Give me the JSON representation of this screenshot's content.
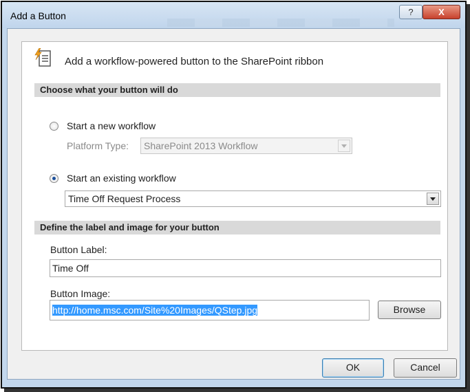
{
  "window": {
    "title": "Add a Button",
    "help_glyph": "?",
    "close_glyph": "X"
  },
  "header": {
    "text": "Add a workflow-powered button to the SharePoint ribbon",
    "icon": "ribbon-button-icon"
  },
  "section1": {
    "title": "Choose what your button will do"
  },
  "option_new": {
    "label": "Start a new workflow",
    "checked": false,
    "platform_label": "Platform Type:",
    "platform_value": "SharePoint 2013 Workflow"
  },
  "option_existing": {
    "label": "Start an existing workflow",
    "checked": true,
    "workflow_value": "Time Off Request Process"
  },
  "section2": {
    "title": "Define the label and image for your button"
  },
  "button_label": {
    "label": "Button Label:",
    "value": "Time Off"
  },
  "button_image": {
    "label": "Button Image:",
    "value": "http://home.msc.com/Site%20Images/QStep.jpg",
    "browse_label": "Browse"
  },
  "footer": {
    "ok_label": "OK",
    "cancel_label": "Cancel"
  },
  "colors": {
    "titlebar": "#c8dbef",
    "close": "#c8412c",
    "selection": "#3399ff",
    "section_bar": "#d9d9d9"
  }
}
